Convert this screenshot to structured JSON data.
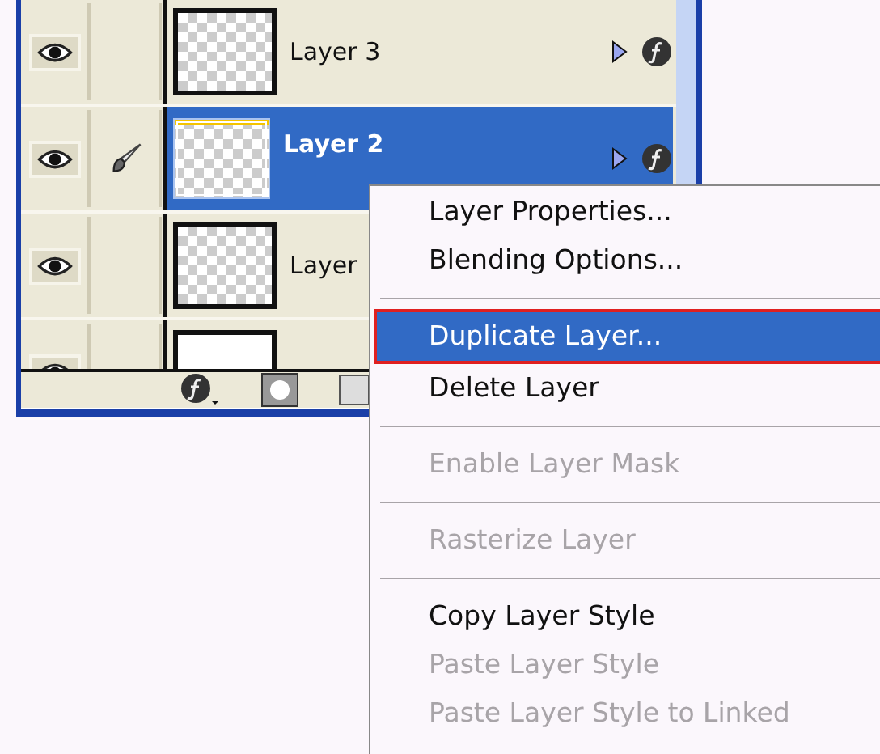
{
  "layers_panel": {
    "layers": [
      {
        "kind": "layer",
        "name": "Layer 3",
        "visible": true,
        "editing": false,
        "selected": false,
        "effects": true
      },
      {
        "kind": "layer",
        "name": "Layer 2",
        "visible": true,
        "editing": true,
        "selected": true,
        "effects": true
      },
      {
        "kind": "layer",
        "name": "Layer",
        "visible": true,
        "editing": false,
        "selected": false,
        "effects": false
      },
      {
        "kind": "background",
        "visible": true,
        "editing": false,
        "selected": false,
        "effects": false
      }
    ]
  },
  "context_menu": {
    "items": [
      {
        "kind": "item",
        "label": "Layer Properties...",
        "disabled": false,
        "selected": false
      },
      {
        "kind": "item",
        "label": "Blending Options...",
        "disabled": false,
        "selected": false
      },
      {
        "kind": "separator"
      },
      {
        "kind": "item",
        "label": "Duplicate Layer...",
        "disabled": false,
        "selected": true
      },
      {
        "kind": "item",
        "label": "Delete Layer",
        "disabled": false,
        "selected": false
      },
      {
        "kind": "separator"
      },
      {
        "kind": "item",
        "label": "Enable Layer Mask",
        "disabled": true,
        "selected": false
      },
      {
        "kind": "separator"
      },
      {
        "kind": "item",
        "label": "Rasterize Layer",
        "disabled": true,
        "selected": false
      },
      {
        "kind": "separator"
      },
      {
        "kind": "item",
        "label": "Copy Layer Style",
        "disabled": false,
        "selected": false
      },
      {
        "kind": "item",
        "label": "Paste Layer Style",
        "disabled": true,
        "selected": false
      },
      {
        "kind": "item",
        "label": "Paste Layer Style to Linked",
        "disabled": true,
        "selected": false
      }
    ]
  }
}
